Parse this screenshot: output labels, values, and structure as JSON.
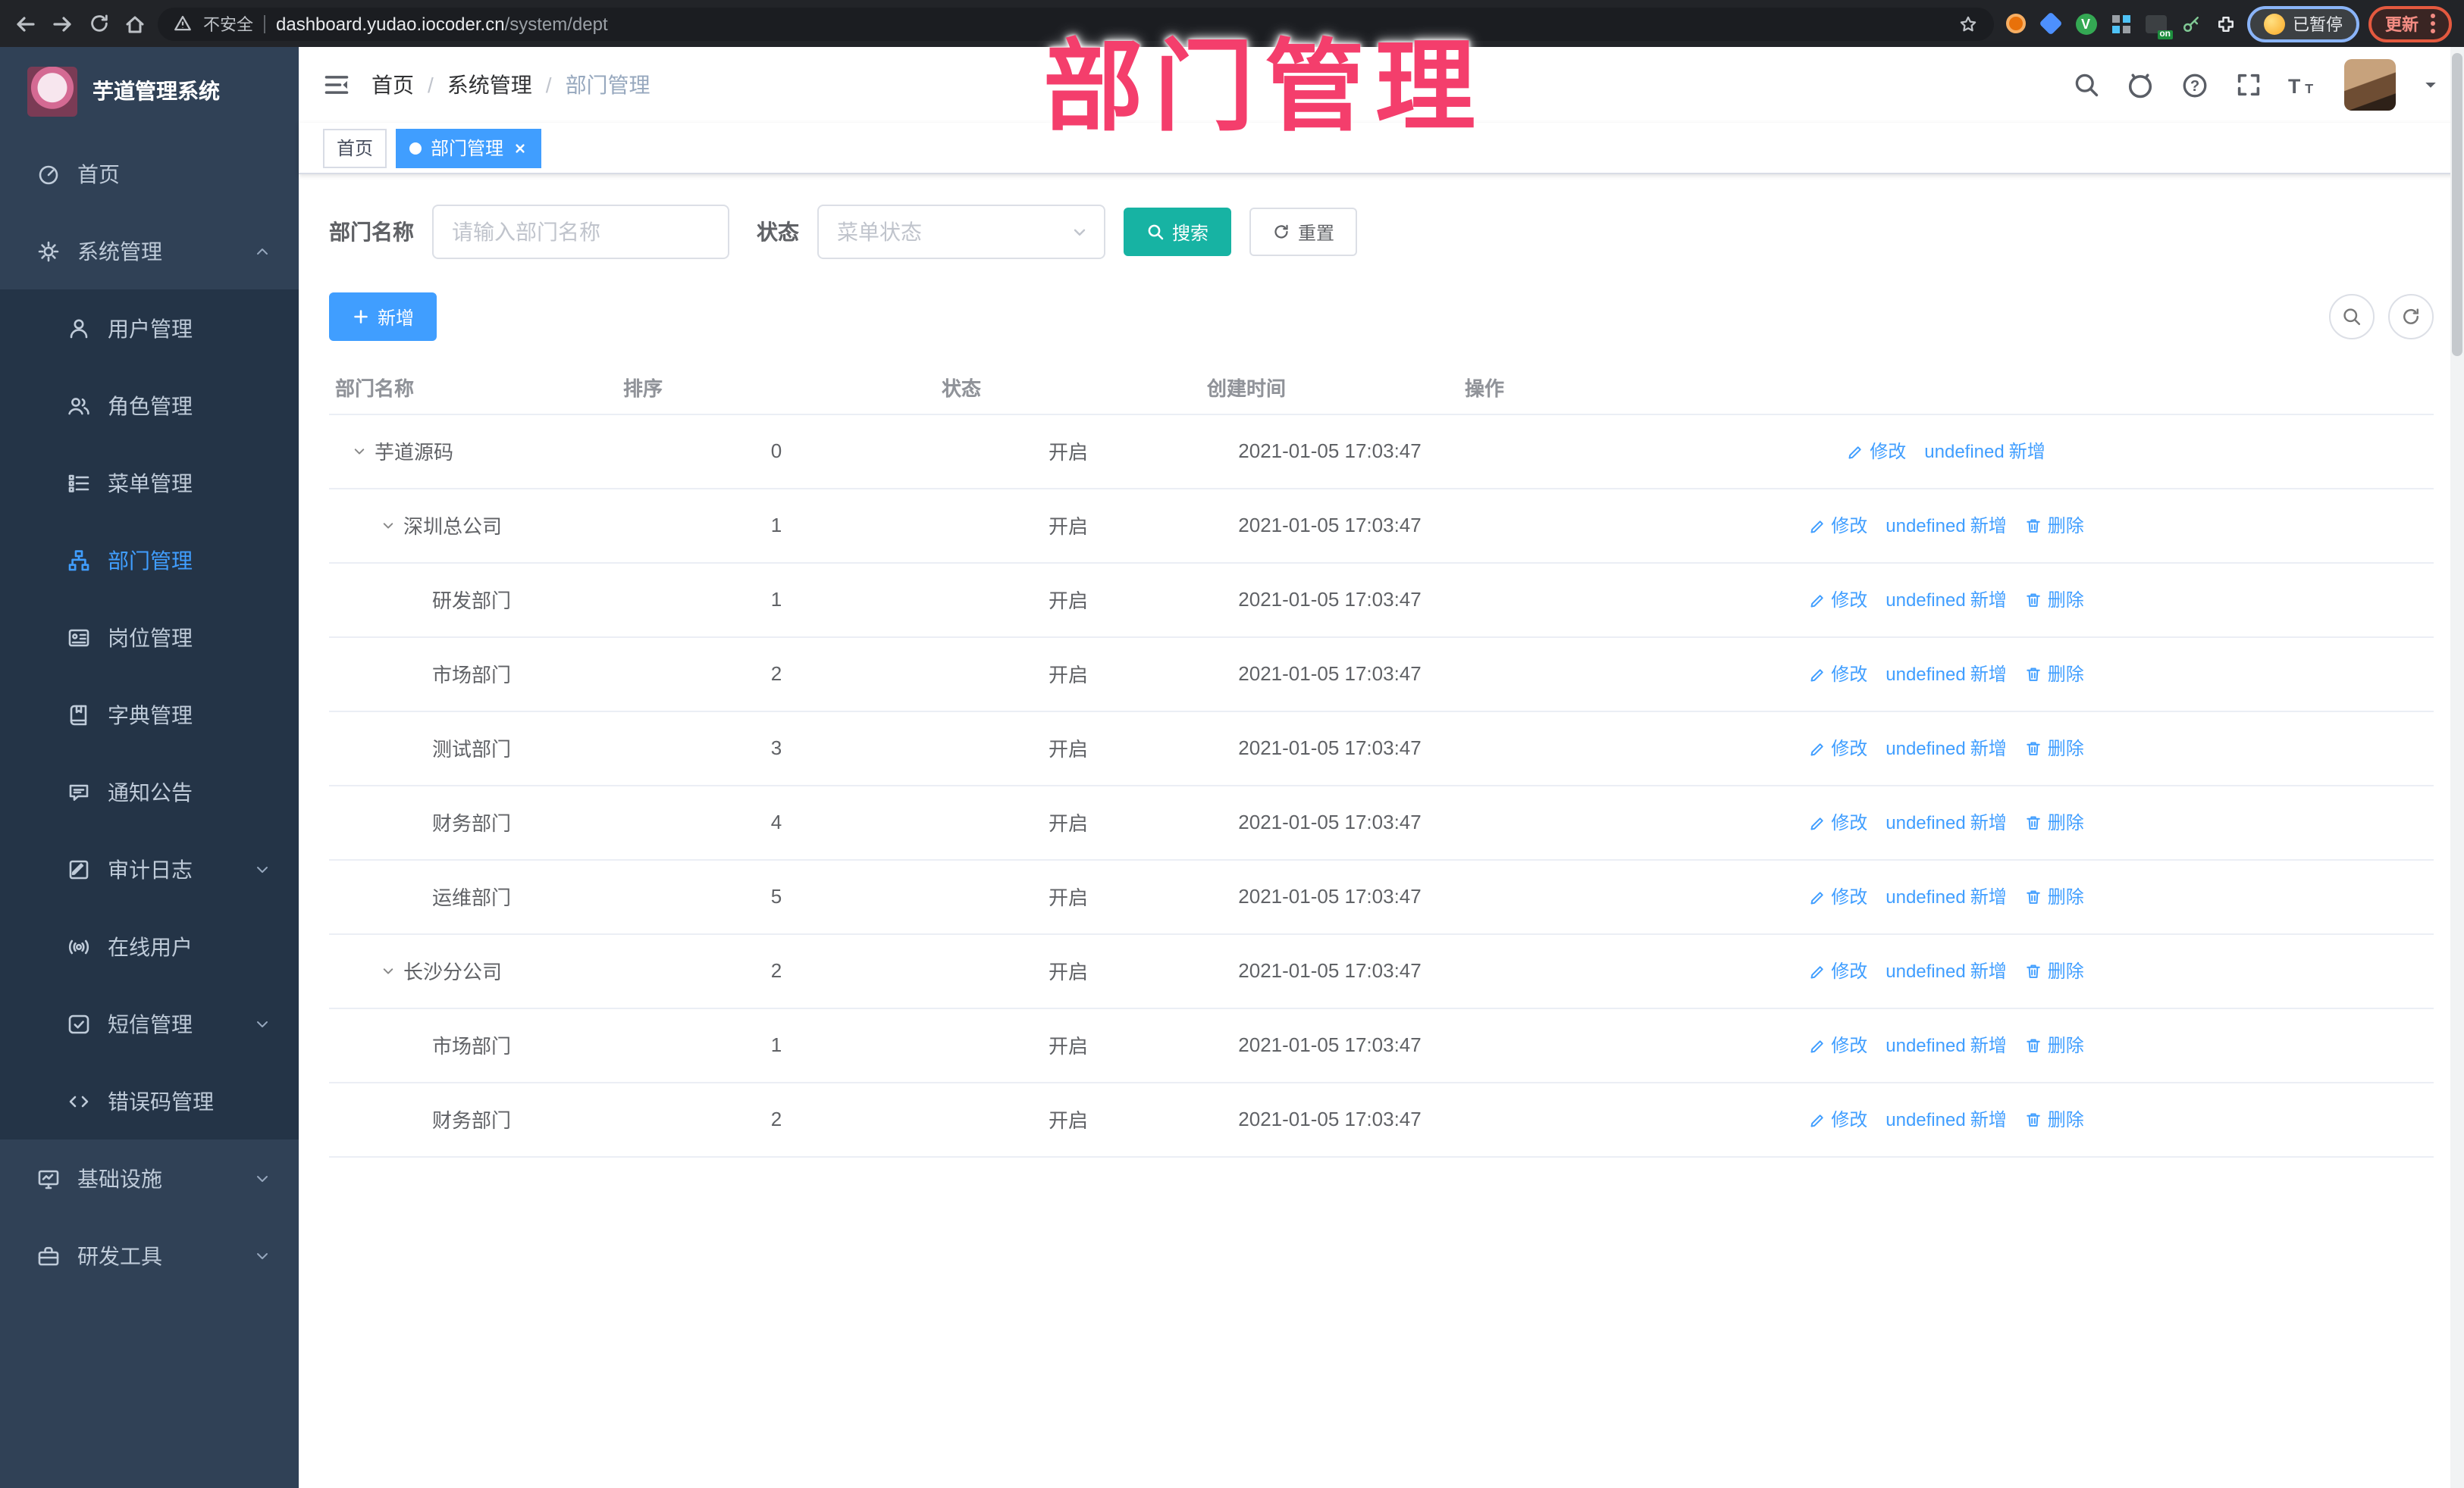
{
  "browser": {
    "security_label": "不安全",
    "url_domain": "dashboard.yudao.iocoder.cn",
    "url_path": "/system/dept",
    "profile_chip_label": "已暂停",
    "update_button_label": "更新",
    "extension_badge": "on"
  },
  "overlay": {
    "title": "部门管理"
  },
  "sidebar": {
    "app_title": "芋道管理系统",
    "items": [
      {
        "label": "首页",
        "icon": "dashboard-icon",
        "level": 0
      },
      {
        "label": "系统管理",
        "icon": "gear-icon",
        "level": 0,
        "arrow": "up"
      },
      {
        "label": "用户管理",
        "icon": "user-icon",
        "level": 1
      },
      {
        "label": "角色管理",
        "icon": "users-icon",
        "level": 1
      },
      {
        "label": "菜单管理",
        "icon": "menu-tree-icon",
        "level": 1
      },
      {
        "label": "部门管理",
        "icon": "org-tree-icon",
        "level": 1,
        "active": true
      },
      {
        "label": "岗位管理",
        "icon": "id-card-icon",
        "level": 1
      },
      {
        "label": "字典管理",
        "icon": "dictionary-icon",
        "level": 1
      },
      {
        "label": "通知公告",
        "icon": "announcement-icon",
        "level": 1
      },
      {
        "label": "审计日志",
        "icon": "audit-log-icon",
        "level": 1,
        "arrow": "down"
      },
      {
        "label": "在线用户",
        "icon": "online-user-icon",
        "level": 1
      },
      {
        "label": "短信管理",
        "icon": "sms-icon",
        "level": 1,
        "arrow": "down"
      },
      {
        "label": "错误码管理",
        "icon": "error-code-icon",
        "level": 1
      },
      {
        "label": "基础设施",
        "icon": "infrastructure-icon",
        "level": 0,
        "arrow": "down"
      },
      {
        "label": "研发工具",
        "icon": "dev-tools-icon",
        "level": 0,
        "arrow": "down"
      }
    ]
  },
  "header": {
    "breadcrumb": [
      "首页",
      "系统管理",
      "部门管理"
    ],
    "tabs": [
      {
        "label": "首页",
        "active": false
      },
      {
        "label": "部门管理",
        "active": true,
        "closable": true
      }
    ]
  },
  "toolbar": {
    "dept_name_label": "部门名称",
    "dept_name_placeholder": "请输入部门名称",
    "status_label": "状态",
    "status_placeholder": "菜单状态",
    "search_label": "搜索",
    "reset_label": "重置",
    "add_label": "新增"
  },
  "table": {
    "columns": [
      "部门名称",
      "排序",
      "状态",
      "创建时间",
      "操作"
    ],
    "action_labels": {
      "edit": "修改",
      "add": "新增",
      "delete": "删除"
    },
    "rows": [
      {
        "name": "芋道源码",
        "level": 0,
        "expandable": true,
        "sort": "0",
        "status": "开启",
        "created": "2021-01-05 17:03:47",
        "actions": [
          "edit",
          "add"
        ]
      },
      {
        "name": "深圳总公司",
        "level": 1,
        "expandable": true,
        "sort": "1",
        "status": "开启",
        "created": "2021-01-05 17:03:47",
        "actions": [
          "edit",
          "add",
          "delete"
        ]
      },
      {
        "name": "研发部门",
        "level": 2,
        "expandable": false,
        "sort": "1",
        "status": "开启",
        "created": "2021-01-05 17:03:47",
        "actions": [
          "edit",
          "add",
          "delete"
        ]
      },
      {
        "name": "市场部门",
        "level": 2,
        "expandable": false,
        "sort": "2",
        "status": "开启",
        "created": "2021-01-05 17:03:47",
        "actions": [
          "edit",
          "add",
          "delete"
        ]
      },
      {
        "name": "测试部门",
        "level": 2,
        "expandable": false,
        "sort": "3",
        "status": "开启",
        "created": "2021-01-05 17:03:47",
        "actions": [
          "edit",
          "add",
          "delete"
        ]
      },
      {
        "name": "财务部门",
        "level": 2,
        "expandable": false,
        "sort": "4",
        "status": "开启",
        "created": "2021-01-05 17:03:47",
        "actions": [
          "edit",
          "add",
          "delete"
        ]
      },
      {
        "name": "运维部门",
        "level": 2,
        "expandable": false,
        "sort": "5",
        "status": "开启",
        "created": "2021-01-05 17:03:47",
        "actions": [
          "edit",
          "add",
          "delete"
        ]
      },
      {
        "name": "长沙分公司",
        "level": 1,
        "expandable": true,
        "sort": "2",
        "status": "开启",
        "created": "2021-01-05 17:03:47",
        "actions": [
          "edit",
          "add",
          "delete"
        ]
      },
      {
        "name": "市场部门",
        "level": 2,
        "expandable": false,
        "sort": "1",
        "status": "开启",
        "created": "2021-01-05 17:03:47",
        "actions": [
          "edit",
          "add",
          "delete"
        ]
      },
      {
        "name": "财务部门",
        "level": 2,
        "expandable": false,
        "sort": "2",
        "status": "开启",
        "created": "2021-01-05 17:03:47",
        "actions": [
          "edit",
          "add",
          "delete"
        ]
      }
    ]
  },
  "colors": {
    "accent": "#409eff",
    "search_button": "#17b3a3",
    "annotation": "#f43e6c",
    "sidebar_bg": "#304156",
    "submenu_bg": "#243447",
    "status_text": "#606266"
  }
}
